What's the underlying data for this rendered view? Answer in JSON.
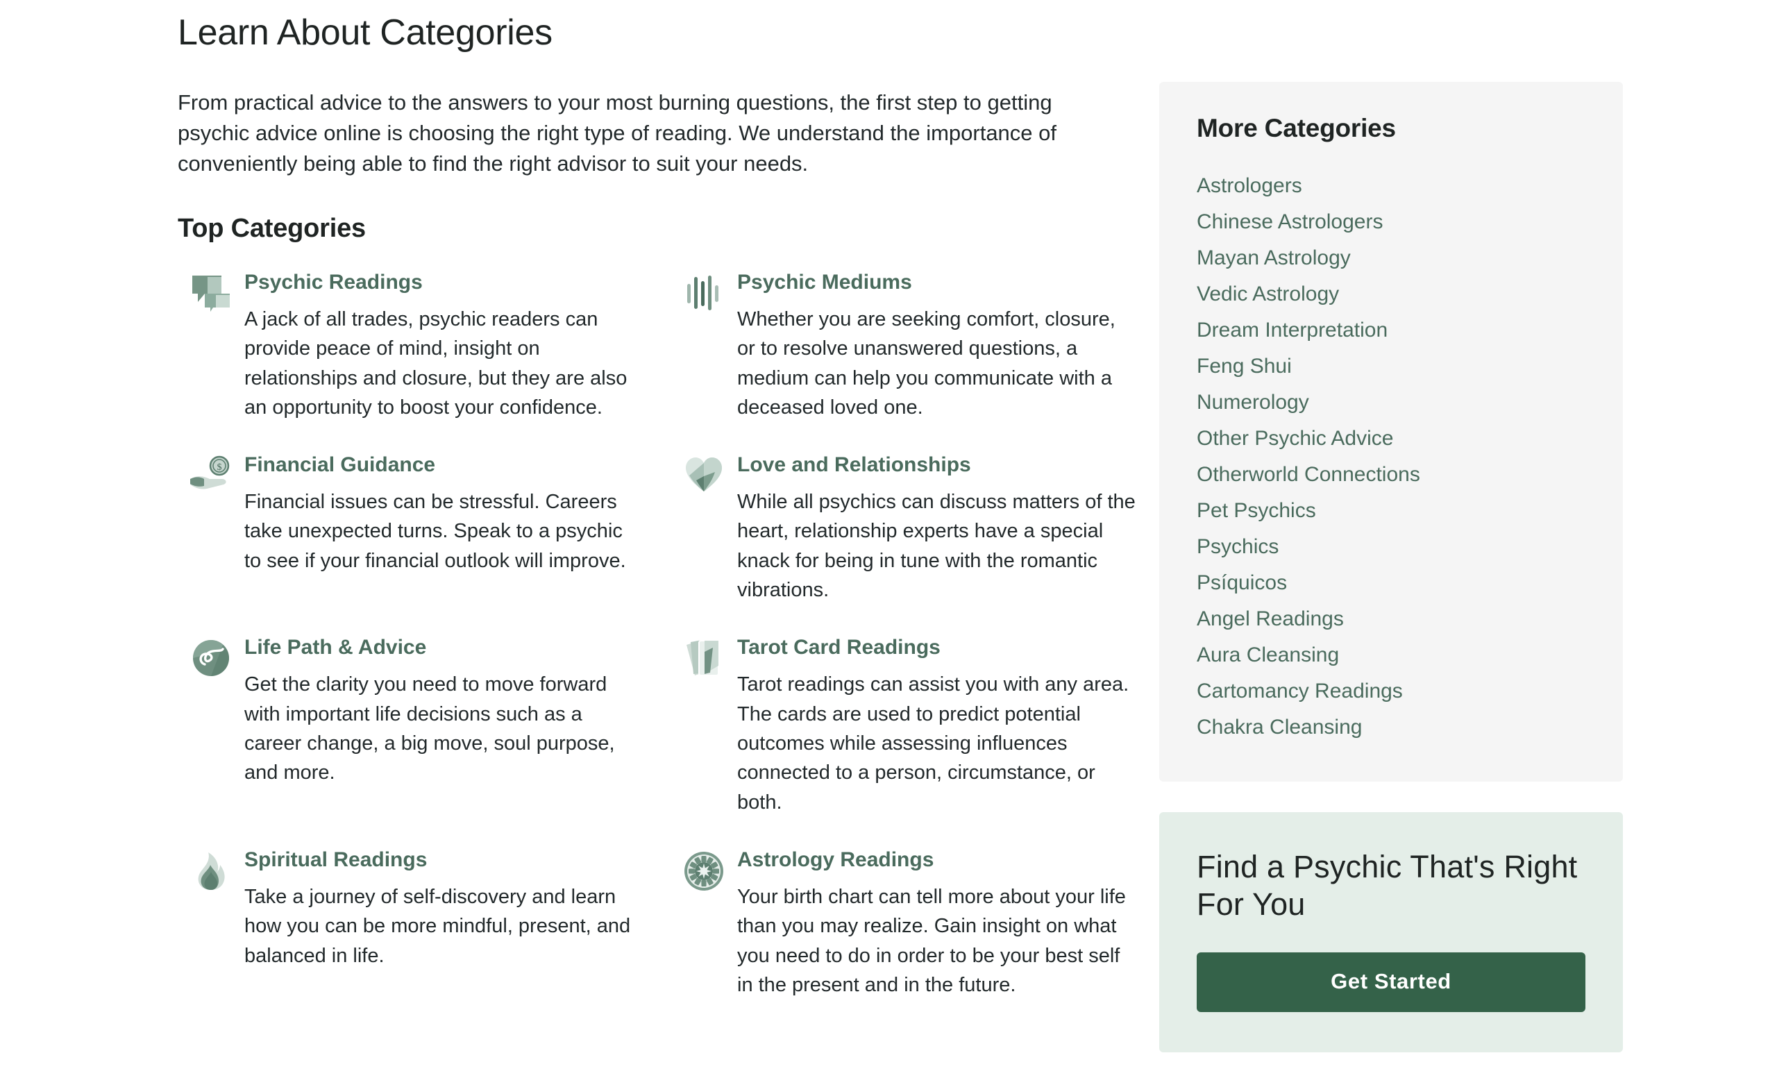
{
  "main": {
    "page_title": "Learn About Categories",
    "intro": "From practical advice to the answers to your most burning questions, the first step to getting psychic advice online is choosing the right type of reading. We understand the importance of conveniently being able to find the right advisor to suit your needs.",
    "section_title": "Top Categories",
    "categories": [
      {
        "name": "Psychic Readings",
        "description": "A jack of all trades, psychic readers can provide peace of mind, insight on relationships and closure, but they are also an opportunity to boost your confidence.",
        "icon": "speech-bubbles-icon"
      },
      {
        "name": "Psychic Mediums",
        "description": "Whether you are seeking comfort, closure, or to resolve unanswered questions, a medium can help you communicate with a deceased loved one.",
        "icon": "sound-waves-icon"
      },
      {
        "name": "Financial Guidance",
        "description": "Financial issues can be stressful. Careers take unexpected turns. Speak to a psychic to see if your financial outlook will improve.",
        "icon": "hand-with-coin-icon"
      },
      {
        "name": "Love and Relationships",
        "description": "While all psychics can discuss matters of the heart, relationship experts have a special knack for being in tune with the romantic vibrations.",
        "icon": "heart-icon"
      },
      {
        "name": "Life Path & Advice",
        "description": "Get the clarity you need to move forward with important life decisions such as a career change, a big move, soul purpose, and more.",
        "icon": "crystal-ball-path-icon"
      },
      {
        "name": "Tarot Card Readings",
        "description": "Tarot readings can assist you with any area. The cards are used to predict potential outcomes while assessing influences connected to a person, circumstance, or both.",
        "icon": "tarot-cards-icon"
      },
      {
        "name": "Spiritual Readings",
        "description": "Take a journey of self-discovery and learn how you can be more mindful, present, and balanced in life.",
        "icon": "flame-icon"
      },
      {
        "name": "Astrology Readings",
        "description": "Your birth chart can tell more about your life than you may realize. Gain insight on what you need to do in order to be your best self in the present and in the future.",
        "icon": "zodiac-wheel-icon"
      }
    ]
  },
  "sidebar": {
    "more_categories_title": "More Categories",
    "more_categories": [
      "Astrologers",
      "Chinese Astrologers",
      "Mayan Astrology",
      "Vedic Astrology",
      "Dream Interpretation",
      "Feng Shui",
      "Numerology",
      "Other Psychic Advice",
      "Otherworld Connections",
      "Pet Psychics",
      "Psychics",
      "Psíquicos",
      "Angel Readings",
      "Aura Cleansing",
      "Cartomancy Readings",
      "Chakra Cleansing"
    ],
    "cta": {
      "title": "Find a Psychic That's Right For You",
      "button_label": "Get Started"
    }
  },
  "colors": {
    "accent_green": "#4a6b5d",
    "button_green": "#346249",
    "cta_background": "#e4eee8",
    "card_background": "#f5f5f5",
    "text_dark": "#22292b"
  }
}
